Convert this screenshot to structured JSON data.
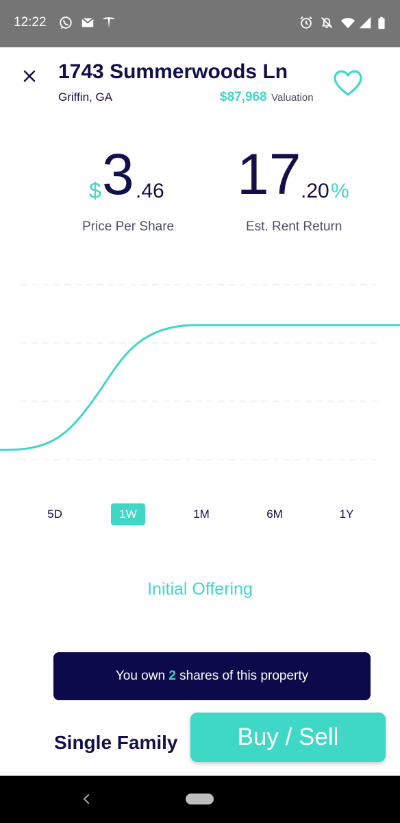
{
  "status_bar": {
    "time": "12:22",
    "icons": [
      "whatsapp-icon",
      "gmail-icon",
      "tesla-icon",
      "alarm-icon",
      "notifications-off-icon",
      "wifi-icon",
      "signal-icon",
      "battery-icon"
    ]
  },
  "header": {
    "title": "1743 Summerwoods Ln",
    "city": "Griffin, GA",
    "valuation_amount": "$87,968",
    "valuation_label": "Valuation"
  },
  "stats": {
    "price": {
      "currency": "$",
      "integer": "3",
      "decimal": ".46",
      "label": "Price Per Share"
    },
    "rent": {
      "integer": "17",
      "decimal": ".20",
      "percent": "%",
      "label": "Est. Rent Return"
    }
  },
  "ranges": [
    {
      "label": "5D",
      "active": false
    },
    {
      "label": "1W",
      "active": true
    },
    {
      "label": "1M",
      "active": false
    },
    {
      "label": "6M",
      "active": false
    },
    {
      "label": "1Y",
      "active": false
    }
  ],
  "offering_label": "Initial Offering",
  "ownership": {
    "prefix": "You own",
    "count": "2",
    "suffix": "shares of this property"
  },
  "property_type": "Single Family",
  "buy_sell_label": "Buy / Sell",
  "colors": {
    "accent": "#3fd7c6",
    "navy": "#0c0a4a",
    "status_bar": "#757575",
    "nav_bar": "#000000"
  }
}
